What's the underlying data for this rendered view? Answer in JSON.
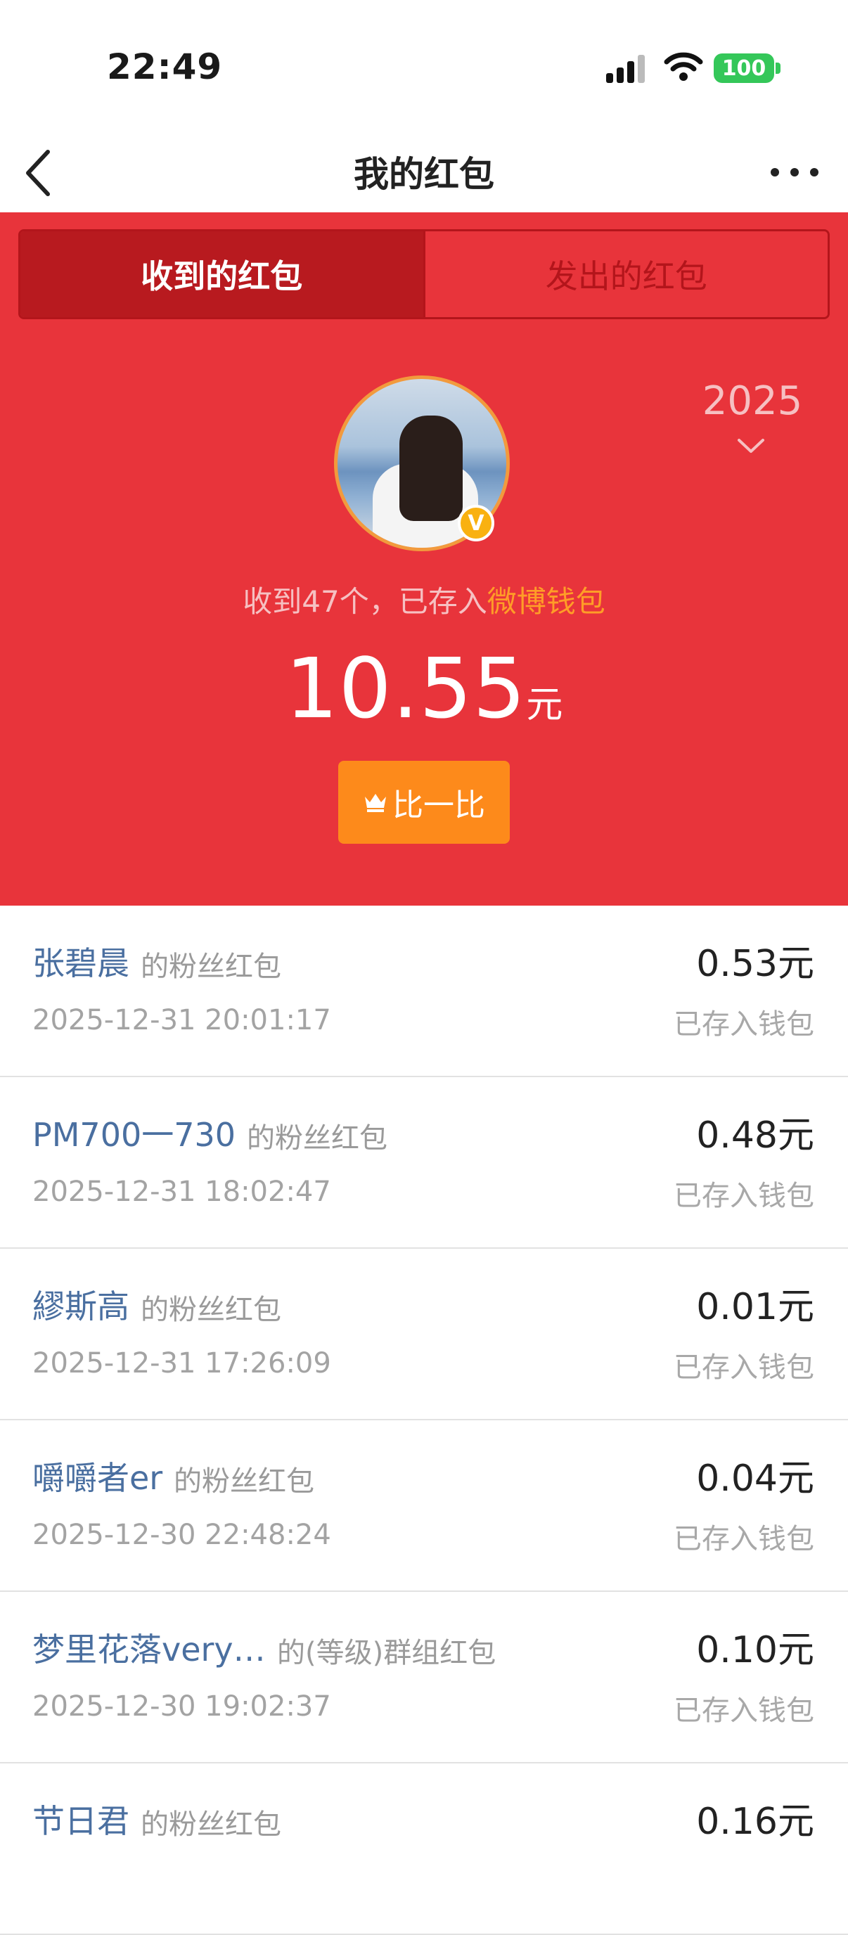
{
  "status_bar": {
    "time": "22:49",
    "battery": "100"
  },
  "nav": {
    "title": "我的红包"
  },
  "tabs": {
    "received": "收到的红包",
    "sent": "发出的红包"
  },
  "header": {
    "year": "2025",
    "summary_prefix": "收到47个，已存入",
    "wallet_link": "微博钱包",
    "amount": "10.55",
    "unit": "元",
    "compare_button": "比一比"
  },
  "colors": {
    "red": "#e8343b",
    "dark_red": "#b81a1f",
    "orange": "#fd8a1b",
    "link_blue": "#4a6fa0"
  },
  "entries": [
    {
      "name": "张碧晨",
      "type": "的粉丝红包",
      "date": "2025-12-31 20:01:17",
      "amount": "0.53元",
      "status": "已存入钱包"
    },
    {
      "name": "PM700一730",
      "type": "的粉丝红包",
      "date": "2025-12-31 18:02:47",
      "amount": "0.48元",
      "status": "已存入钱包"
    },
    {
      "name": "繆斯高",
      "type": "的粉丝红包",
      "date": "2025-12-31 17:26:09",
      "amount": "0.01元",
      "status": "已存入钱包"
    },
    {
      "name": "嚼嚼者er",
      "type": "的粉丝红包",
      "date": "2025-12-30 22:48:24",
      "amount": "0.04元",
      "status": "已存入钱包"
    },
    {
      "name": "梦里花落very…",
      "type": "的(等级)群组红包",
      "date": "2025-12-30 19:02:37",
      "amount": "0.10元",
      "status": "已存入钱包"
    },
    {
      "name": "节日君",
      "type": "的粉丝红包",
      "date": "",
      "amount": "0.16元",
      "status": ""
    }
  ]
}
